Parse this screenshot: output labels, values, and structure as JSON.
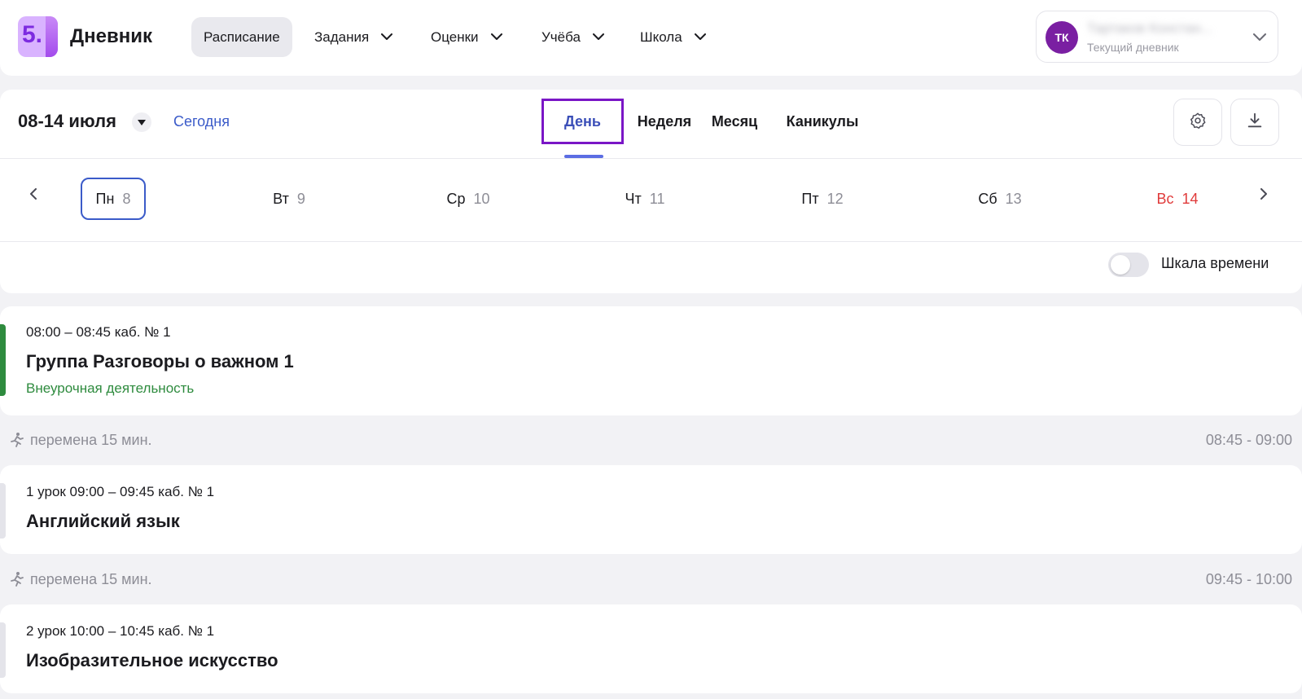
{
  "app": {
    "logo_text": "5.",
    "brand": "Дневник"
  },
  "nav": {
    "items": [
      {
        "label": "Расписание",
        "active": true,
        "dropdown": false
      },
      {
        "label": "Задания",
        "active": false,
        "dropdown": true
      },
      {
        "label": "Оценки",
        "active": false,
        "dropdown": true
      },
      {
        "label": "Учёба",
        "active": false,
        "dropdown": true
      },
      {
        "label": "Школа",
        "active": false,
        "dropdown": true
      }
    ]
  },
  "profile": {
    "initials": "ТК",
    "name": "Тартаков Констан...",
    "subtitle": "Текущий дневник",
    "avatar_color": "#7a1fa2"
  },
  "schedule": {
    "date_range": "08-14 июля",
    "today_label": "Сегодня",
    "views": [
      {
        "label": "День",
        "active": true
      },
      {
        "label": "Неделя",
        "active": false
      },
      {
        "label": "Месяц",
        "active": false
      },
      {
        "label": "Каникулы",
        "active": false
      }
    ],
    "settings_icon": "gear-icon",
    "download_icon": "download-icon",
    "days": [
      {
        "name": "Пн",
        "num": "8",
        "selected": true
      },
      {
        "name": "Вт",
        "num": "9"
      },
      {
        "name": "Ср",
        "num": "10"
      },
      {
        "name": "Чт",
        "num": "11"
      },
      {
        "name": "Пт",
        "num": "12"
      },
      {
        "name": "Сб",
        "num": "13"
      },
      {
        "name": "Вс",
        "num": "14",
        "weekend": true
      }
    ],
    "timescale_label": "Шкала времени",
    "timescale_on": false
  },
  "lessons": [
    {
      "meta": "08:00 – 08:45 каб. № 1",
      "title": "Группа Разговоры о важном 1",
      "type": "Внеурочная деятельность",
      "accent": "#2e8b3e"
    },
    {
      "meta": "1 урок 09:00 – 09:45 каб. № 1",
      "title": "Английский язык",
      "accent": "#e4e4ea"
    },
    {
      "meta": "2 урок 10:00 – 10:45 каб. № 1",
      "title": "Изобразительное искусство",
      "accent": "#e4e4ea"
    }
  ],
  "breaks": [
    {
      "text": "перемена 15 мин.",
      "time": "08:45 - 09:00"
    },
    {
      "text": "перемена 15 мин.",
      "time": "09:45 - 10:00"
    }
  ],
  "colors": {
    "accent_blue": "#3b5bc9",
    "highlight_frame": "#7a16c6",
    "weekend_red": "#e03a3a",
    "extracurricular_green": "#2e8b3e"
  }
}
